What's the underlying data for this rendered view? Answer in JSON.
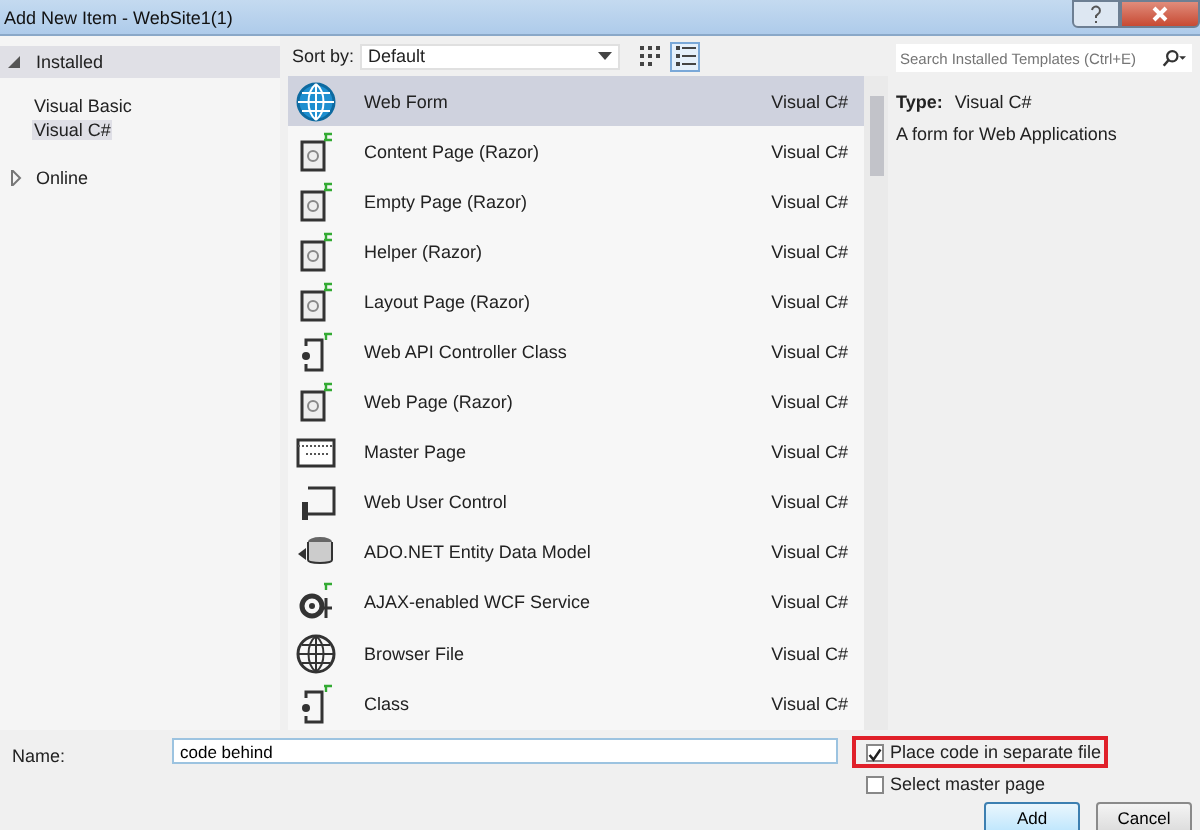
{
  "window": {
    "title": "Add New Item - WebSite1(1)"
  },
  "sidebar": {
    "items": [
      {
        "label": "Installed",
        "expanded": true,
        "selected": false,
        "children": [
          {
            "label": "Visual Basic",
            "selected": false
          },
          {
            "label": "Visual C#",
            "selected": true
          }
        ]
      },
      {
        "label": "Online",
        "expanded": false,
        "selected": false
      }
    ]
  },
  "toolbar": {
    "sort_label": "Sort by:",
    "sort_value": "Default",
    "view_list": true
  },
  "search": {
    "placeholder": "Search Installed Templates (Ctrl+E)"
  },
  "templates": [
    {
      "name": "Web Form",
      "language": "Visual C#",
      "selected": true
    },
    {
      "name": "Content Page (Razor)",
      "language": "Visual C#",
      "selected": false
    },
    {
      "name": "Empty Page (Razor)",
      "language": "Visual C#",
      "selected": false
    },
    {
      "name": "Helper (Razor)",
      "language": "Visual C#",
      "selected": false
    },
    {
      "name": "Layout Page (Razor)",
      "language": "Visual C#",
      "selected": false
    },
    {
      "name": "Web API Controller Class",
      "language": "Visual C#",
      "selected": false
    },
    {
      "name": "Web Page (Razor)",
      "language": "Visual C#",
      "selected": false
    },
    {
      "name": "Master Page",
      "language": "Visual C#",
      "selected": false
    },
    {
      "name": "Web User Control",
      "language": "Visual C#",
      "selected": false
    },
    {
      "name": "ADO.NET Entity Data Model",
      "language": "Visual C#",
      "selected": false
    },
    {
      "name": "AJAX-enabled WCF Service",
      "language": "Visual C#",
      "selected": false
    },
    {
      "name": "Browser File",
      "language": "Visual C#",
      "selected": false
    },
    {
      "name": "Class",
      "language": "Visual C#",
      "selected": false
    }
  ],
  "details": {
    "type_label": "Type:",
    "type_value": "Visual C#",
    "description": "A form for Web Applications"
  },
  "name_field": {
    "label": "Name:",
    "value": "code behind"
  },
  "options": [
    {
      "label": "Place code in separate file",
      "checked": true,
      "highlighted": true
    },
    {
      "label": "Select master page",
      "checked": false,
      "highlighted": false
    }
  ],
  "buttons": [
    {
      "label": "Add",
      "default": true
    },
    {
      "label": "Cancel",
      "default": false
    }
  ]
}
